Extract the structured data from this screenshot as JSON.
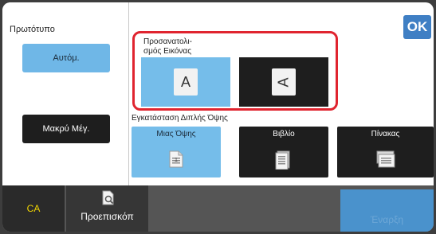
{
  "original": {
    "title": "Πρωτότυπο",
    "auto_label": "Αυτόμ.",
    "long_label": "Μακρύ Μέγ."
  },
  "ok_label": "OK",
  "orientation": {
    "label": "Προσανατολι-\nσμός Εικόνας",
    "portrait_glyph": "A",
    "landscape_glyph": "A",
    "selected": "portrait"
  },
  "duplex": {
    "label": "Εγκατάσταση Διπλής Όψης",
    "options": [
      {
        "label": "Μιας Όψης"
      },
      {
        "label": "Βιβλίο"
      },
      {
        "label": "Πίνακας"
      }
    ],
    "selected": "Μιας Όψης"
  },
  "bottom": {
    "ca_label": "CA",
    "preview_label": "Προεπισκόπ",
    "start_label": "Έναρξη"
  },
  "colors": {
    "selected": "#75bdea",
    "unselected": "#1e1e1e",
    "highlight_border": "#e0242f",
    "ok_blue": "#3f7fc4",
    "ca_yellow": "#f0d400"
  }
}
